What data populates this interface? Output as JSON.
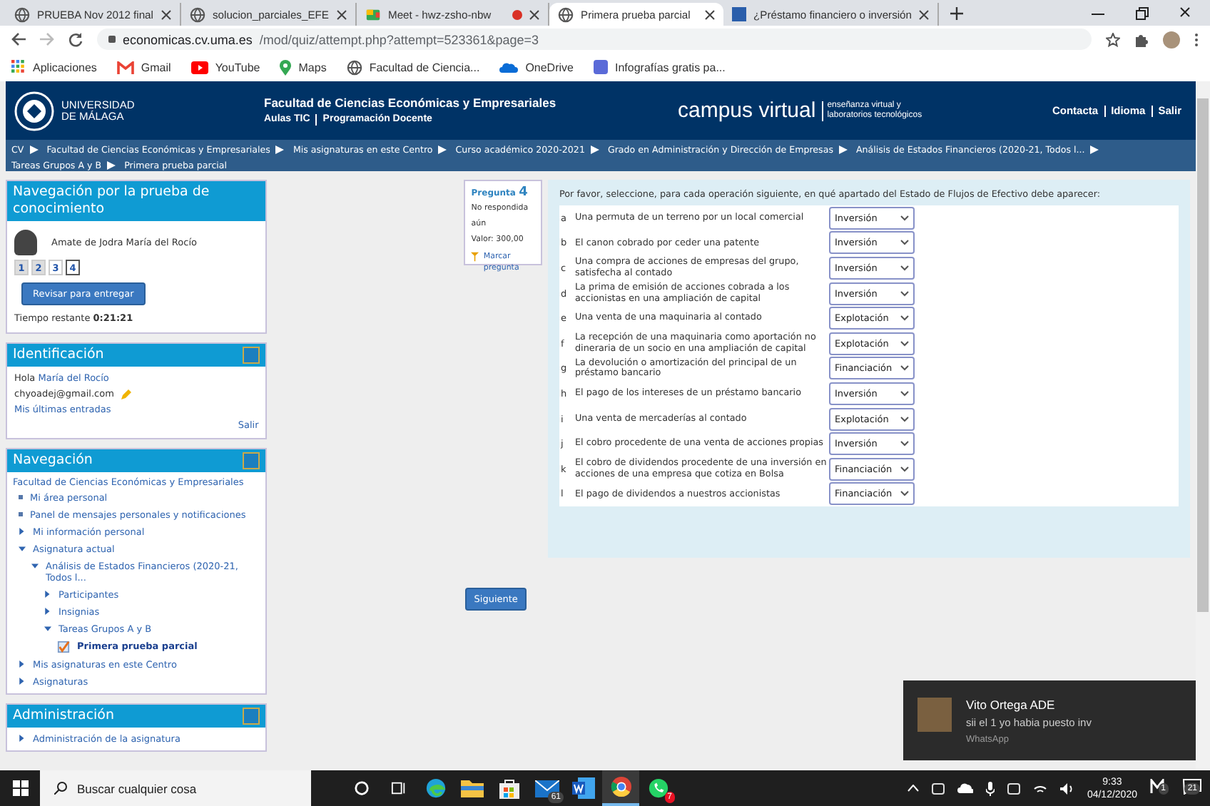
{
  "browser": {
    "tabs": [
      {
        "title": "PRUEBA Nov 2012 final",
        "selected": false,
        "kind": "globe",
        "recording": false
      },
      {
        "title": "solucion_parciales_EFE",
        "selected": false,
        "kind": "globe",
        "recording": false
      },
      {
        "title": "Meet - hwz-zsho-nbw",
        "selected": false,
        "kind": "meet",
        "recording": true
      },
      {
        "title": "Primera prueba parcial",
        "selected": true,
        "kind": "globe",
        "recording": false
      },
      {
        "title": "¿Préstamo financiero o inversión",
        "selected": false,
        "kind": "sd",
        "recording": false
      }
    ],
    "url_host": "economicas.cv.uma.es",
    "url_path": "/mod/quiz/attempt.php?attempt=523361&page=3",
    "bookmarks": [
      {
        "label": "Aplicaciones",
        "kind": "apps"
      },
      {
        "label": "Gmail",
        "kind": "gmail"
      },
      {
        "label": "YouTube",
        "kind": "youtube"
      },
      {
        "label": "Maps",
        "kind": "maps"
      },
      {
        "label": "Facultad de Ciencia...",
        "kind": "globe"
      },
      {
        "label": "OneDrive",
        "kind": "cloud"
      },
      {
        "label": "Infografías gratis pa...",
        "kind": "infog"
      }
    ]
  },
  "header": {
    "university": [
      "UNIVERSIDAD",
      "DE MÁLAGA"
    ],
    "faculty": "Facultad de Ciencias Económicas y Empresariales",
    "sublinks": [
      "Aulas TIC",
      "Programación Docente"
    ],
    "campus": "campus virtual",
    "campus_sub": [
      "enseñanza virtual y",
      "laboratorios tecnológicos"
    ],
    "links": [
      "Contacta",
      "Idioma",
      "Salir"
    ]
  },
  "breadcrumb": [
    "CV",
    "Facultad de Ciencias Económicas y Empresariales",
    "Mis asignaturas en este Centro",
    "Curso académico 2020-2021",
    "Grado en Administración y Dirección de Empresas",
    "Análisis de Estados Financieros (2020-21, Todos l...",
    "Tareas Grupos A y B",
    "Primera prueba parcial"
  ],
  "quiz_nav": {
    "title": "Navegación por la prueba de conocimiento",
    "user": "Amate de Jodra María del Rocío",
    "pages": [
      {
        "label": "1",
        "selected": false,
        "answered": true
      },
      {
        "label": "2",
        "selected": false,
        "answered": true
      },
      {
        "label": "3",
        "selected": false,
        "answered": false
      },
      {
        "label": "4",
        "selected": true,
        "answered": false
      }
    ],
    "submit": "Revisar para entregar",
    "time_label": "Tiempo restante",
    "time": "0:21:21"
  },
  "identification": {
    "title": "Identificación",
    "greeting": "Hola",
    "name": "María del Rocío",
    "email": "chyoadej@gmail.com",
    "recent": "Mis últimas entradas",
    "logout": "Salir"
  },
  "navigation": {
    "title": "Navegación",
    "root": "Facultad de Ciencias Económicas y Empresariales",
    "items": [
      {
        "label": "Mi área personal",
        "kind": "leaf",
        "current": false
      },
      {
        "label": "Panel de mensajes personales y notificaciones",
        "kind": "leaf",
        "current": false
      },
      {
        "label": "Mi información personal",
        "kind": "branch",
        "expanded": false,
        "current": false
      },
      {
        "label": "Asignatura actual",
        "kind": "branch",
        "expanded": true,
        "current": false,
        "children": [
          {
            "label": "Análisis de Estados Financieros (2020-21, Todos l...",
            "kind": "branch",
            "expanded": true,
            "current": false,
            "children": [
              {
                "label": "Participantes",
                "kind": "branch",
                "expanded": false,
                "current": false
              },
              {
                "label": "Insignias",
                "kind": "branch",
                "expanded": false,
                "current": false
              },
              {
                "label": "Tareas Grupos A y B",
                "kind": "branch",
                "expanded": true,
                "current": false,
                "children": [
                  {
                    "label": "Primera prueba parcial",
                    "kind": "quiz",
                    "current": true
                  }
                ]
              }
            ]
          }
        ]
      },
      {
        "label": "Mis asignaturas en este Centro",
        "kind": "branch",
        "expanded": false,
        "current": false
      },
      {
        "label": "Asignaturas",
        "kind": "branch",
        "expanded": false,
        "current": false
      }
    ]
  },
  "administration": {
    "title": "Administración",
    "items": [
      {
        "label": "Administración de la asignatura",
        "kind": "branch",
        "expanded": false,
        "current": false
      }
    ]
  },
  "question": {
    "label": "Pregunta",
    "number": "4",
    "status": "No respondida aún",
    "value": "Valor: 300,00",
    "flag": "Marcar pregunta",
    "prompt": "Por favor, seleccione, para cada operación siguiente, en qué apartado del Estado de Flujos de Efectivo debe aparecer:",
    "rows": [
      {
        "letter": "a",
        "text": "Una permuta de un terreno por un local comercial",
        "answer": "Inversión"
      },
      {
        "letter": "b",
        "text": "El canon cobrado por ceder una patente",
        "answer": "Inversión"
      },
      {
        "letter": "c",
        "text": "Una compra de acciones de empresas del grupo, satisfecha al contado",
        "answer": "Inversión"
      },
      {
        "letter": "d",
        "text": "La prima de emisión de acciones cobrada a los accionistas en una ampliación de capital",
        "answer": "Inversión"
      },
      {
        "letter": "e",
        "text": "Una venta de una maquinaria al contado",
        "answer": "Explotación"
      },
      {
        "letter": "f",
        "text": "La recepción de una maquinaria como aportación no dineraria de un socio en una ampliación de capital",
        "answer": "Explotación"
      },
      {
        "letter": "g",
        "text": "La devolución o amortización del principal de un préstamo bancario",
        "answer": "Financiación"
      },
      {
        "letter": "h",
        "text": "El pago de los intereses de un préstamo bancario",
        "answer": "Inversión"
      },
      {
        "letter": "i",
        "text": "Una venta de mercaderías al contado",
        "answer": "Explotación"
      },
      {
        "letter": "j",
        "text": "El cobro procedente de una venta de acciones propias",
        "answer": "Inversión"
      },
      {
        "letter": "k",
        "text": "El cobro de dividendos procedente de una inversión en acciones de una empresa que cotiza en Bolsa",
        "answer": "Financiación"
      },
      {
        "letter": "l",
        "text": "El pago de dividendos a nuestros accionistas",
        "answer": "Financiación"
      }
    ]
  },
  "next_button": "Siguiente",
  "notification": {
    "sender": "Vito Ortega ADE",
    "message": "sii el 1 yo habia puesto inv",
    "app": "WhatsApp"
  },
  "taskbar": {
    "search": "Buscar cualquier cosa",
    "apps": [
      {
        "kind": "cortana",
        "selected": false
      },
      {
        "kind": "taskview",
        "selected": false
      },
      {
        "kind": "edge",
        "selected": false
      },
      {
        "kind": "folder",
        "selected": false
      },
      {
        "kind": "store",
        "selected": false
      },
      {
        "kind": "mail",
        "badge": "61",
        "selected": false
      },
      {
        "kind": "word",
        "selected": false
      },
      {
        "kind": "chrome",
        "selected": true
      },
      {
        "kind": "whatsapp",
        "badge": "7",
        "selected": false
      }
    ],
    "time": "9:33",
    "date": "04/12/2020",
    "tray_badge": "1",
    "notifications": "21"
  }
}
